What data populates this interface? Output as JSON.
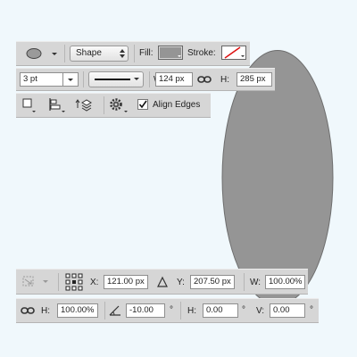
{
  "shape_color": "#959595",
  "toolbar": {
    "mode_value": "Shape",
    "fill_label": "Fill:",
    "fill_color": "#959595",
    "stroke_label": "Stroke:",
    "stroke_width": "3 pt",
    "width_label": "W:",
    "width_value": "124 px",
    "height_label": "H:",
    "height_value": "285 px",
    "align_edges_label": "Align Edges",
    "align_edges_checked": true
  },
  "transform": {
    "x_label": "X:",
    "x_value": "121.00 px",
    "y_label": "Y:",
    "y_value": "207.50 px",
    "w_label": "W:",
    "w_value": "100.00%",
    "h_label": "H:",
    "h_value": "100.00%",
    "angle_value": "-10.00",
    "angle_unit": "°",
    "skew_h_label": "H:",
    "skew_h_value": "0.00",
    "skew_h_unit": "°",
    "skew_v_label": "V:",
    "skew_v_value": "0.00",
    "skew_v_unit": "°"
  },
  "icons": {
    "tool": "ellipse-tool-icon",
    "dropdown": "chevron-down-icon",
    "link": "link-icon",
    "path_ops": "path-operations-icon",
    "path_align": "path-alignment-icon",
    "path_arrange": "path-arrangement-icon",
    "gear": "gear-icon",
    "reference_point": "reference-point-icon",
    "delta": "delta-icon",
    "angle": "angle-icon"
  }
}
